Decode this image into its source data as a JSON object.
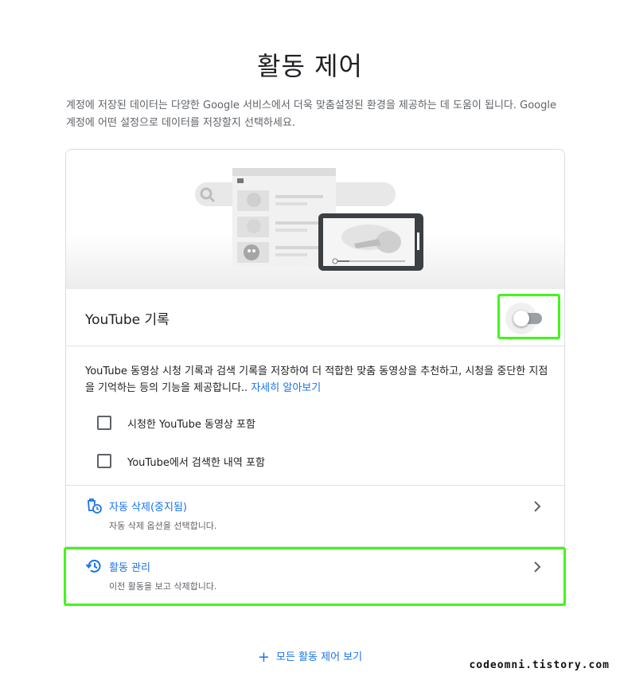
{
  "page": {
    "title": "활동 제어",
    "intro": "계정에 저장된 데이터는 다양한 Google 서비스에서 더욱 맞춤설정된 환경을 제공하는 데 도움이 됩니다. Google 계정에 어떤 설정으로 데이터를 저장할지 선택하세요."
  },
  "setting": {
    "label": "YouTube 기록",
    "toggle_state": "off",
    "description": "YouTube 동영상 시청 기록과 검색 기록을 저장하여 더 적합한 맞춤 동영상을 추천하고, 시청을 중단한 지점을 기억하는 등의 기능을 제공합니다..",
    "learn_more": "자세히 알아보기",
    "options": [
      {
        "label": "시청한 YouTube 동영상 포함",
        "checked": false
      },
      {
        "label": "YouTube에서 검색한 내역 포함",
        "checked": false
      }
    ]
  },
  "links": {
    "auto_delete": {
      "title": "자동 삭제(중지됨)",
      "subtitle": "자동 삭제 옵션을 선택합니다.",
      "icon": "auto-delete-icon"
    },
    "manage_activity": {
      "title": "활동 관리",
      "subtitle": "이전 활동을 보고 삭제합니다.",
      "icon": "history-icon"
    }
  },
  "footer": {
    "plus_icon": "+",
    "all_controls": "모든 활동 제어 보기"
  },
  "watermark": "codeomni.tistory.com",
  "colors": {
    "accent": "#1a73e8",
    "highlight": "#43f51a",
    "toggle_track": "#9aa0a6"
  }
}
